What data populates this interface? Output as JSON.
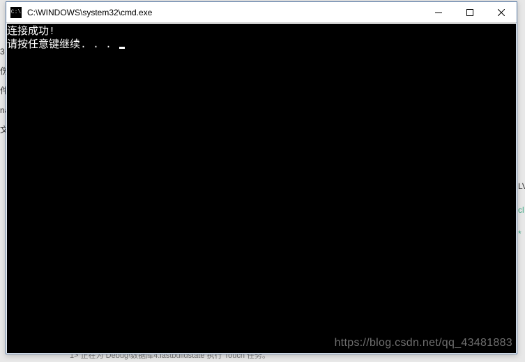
{
  "window": {
    "title": "C:\\WINDOWS\\system32\\cmd.exe",
    "icon_label": "cmd-icon",
    "icon_text": "C:\\"
  },
  "console": {
    "line1": "连接成功!",
    "line2": "请按任意键继续. . . "
  },
  "background": {
    "left_fragments": [
      "3",
      "",
      "伤",
      "件",
      "",
      "na",
      "文"
    ],
    "right_fragments": [
      "LV",
      "cl",
      "*"
    ],
    "bottom_text": "1>  正在为   Debug\\数据库4.lastbuildstate   执行 Touch 任务。"
  },
  "watermark": "https://blog.csdn.net/qq_43481883"
}
